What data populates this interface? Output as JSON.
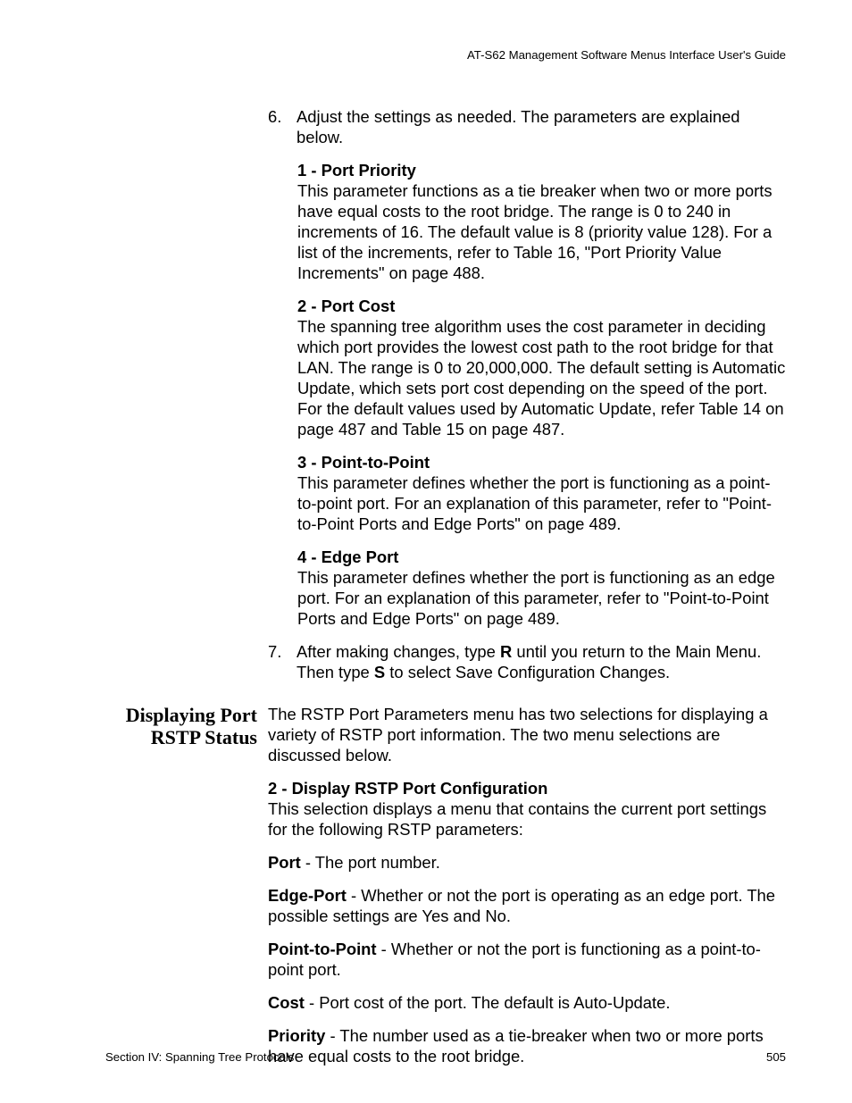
{
  "running_head": "AT-S62 Management Software Menus Interface User's Guide",
  "step6": {
    "num": "6.",
    "text": "Adjust the settings as needed. The parameters are explained below."
  },
  "param1": {
    "title": "1 - Port Priority",
    "body": "This parameter functions as a tie breaker when two or more ports have equal costs to the root bridge. The range is 0 to 240 in increments of 16. The default value is 8 (priority value 128). For a list of the increments, refer to Table 16, \"Port Priority Value Increments\" on page 488."
  },
  "param2": {
    "title": "2 - Port Cost",
    "body": "The spanning tree algorithm uses the cost parameter in deciding which port provides the lowest cost path to the root bridge for that LAN. The range is 0 to 20,000,000. The default setting is Automatic Update, which sets port cost depending on the speed of the port. For the default values used by Automatic Update, refer Table 14 on page 487 and Table 15 on page 487."
  },
  "param3": {
    "title": "3 - Point-to-Point",
    "body": "This parameter defines whether the port is functioning as a point-to-point port. For an explanation of this parameter, refer to \"Point-to-Point Ports and Edge Ports\" on page 489."
  },
  "param4": {
    "title": "4 - Edge Port",
    "body": "This parameter defines whether the port is functioning as an edge port. For an explanation of this parameter, refer to \"Point-to-Point Ports and Edge Ports\" on page 489."
  },
  "step7": {
    "num": "7.",
    "pre": "After making changes, type ",
    "b1": "R",
    "mid": " until you return to the Main Menu. Then type ",
    "b2": "S",
    "post": " to select Save Configuration Changes."
  },
  "section": {
    "title_l1": "Displaying Port",
    "title_l2": "RSTP Status",
    "intro": "The RSTP Port Parameters menu has two selections for displaying a variety of RSTP port information. The two menu selections are discussed below.",
    "sub_title": "2 - Display RSTP Port Configuration",
    "sub_body": "This selection displays a menu that contains the current port settings for the following RSTP parameters:",
    "defs": {
      "port_b": "Port",
      "port_t": " - The port number.",
      "edge_b": "Edge-Port",
      "edge_t": " - Whether or not the port is operating as an edge port. The possible settings are Yes and No.",
      "ptp_b": "Point-to-Point",
      "ptp_t": " - Whether or not the port is functioning as a point-to-point port.",
      "cost_b": "Cost",
      "cost_t": " - Port cost of the port. The default is Auto-Update.",
      "prio_b": "Priority",
      "prio_t": " - The number used as a tie-breaker when two or more ports have equal costs to the root bridge."
    }
  },
  "footer_left": "Section IV: Spanning Tree Protocols",
  "footer_right": "505"
}
